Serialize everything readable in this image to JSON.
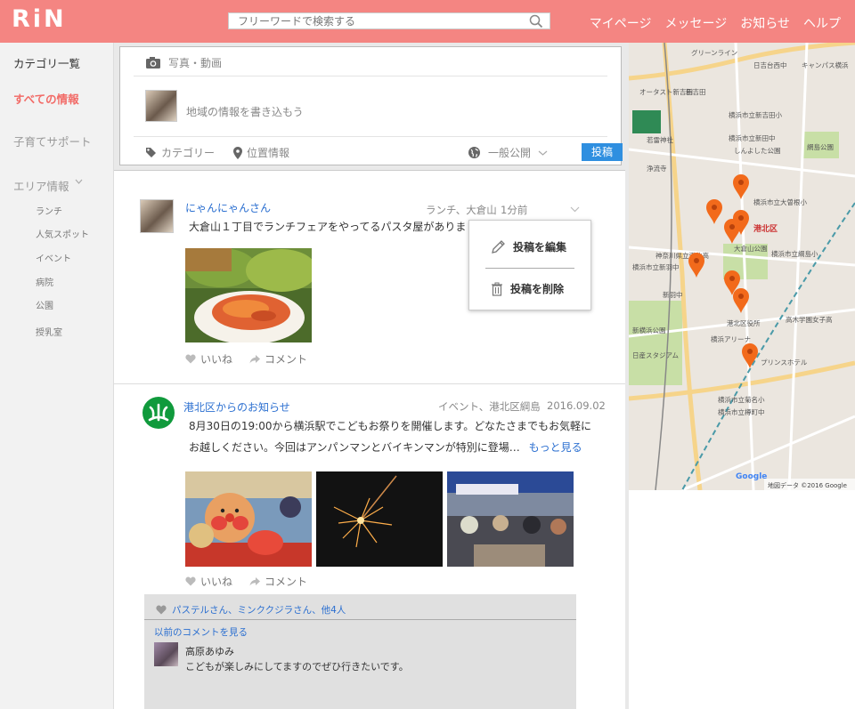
{
  "header": {
    "logo": "RiN",
    "search_placeholder": "フリーワードで検索する",
    "nav": [
      "マイページ",
      "メッセージ",
      "お知らせ",
      "ヘルプ"
    ]
  },
  "sidebar": {
    "category_list": "カテゴリ一覧",
    "all_info": "すべての情報",
    "childcare": "子育てサポート",
    "area_info": "エリア情報",
    "area_items": [
      "ランチ",
      "人気スポット",
      "イベント",
      "病院",
      "公園",
      "授乳室"
    ]
  },
  "composer": {
    "photo_video": "写真・動画",
    "placeholder": "地域の情報を書き込もう",
    "category": "カテゴリー",
    "location": "位置情報",
    "visibility": "一般公開",
    "post_button": "投稿"
  },
  "posts": [
    {
      "user": "にゃんにゃんさん",
      "meta": "ランチ、大倉山",
      "time": "1分前",
      "text": "大倉山１丁目でランチフェアをやってるパスタ屋がありま",
      "like": "いいね",
      "comment": "コメント"
    },
    {
      "user": "港北区からのお知らせ",
      "meta": "イベント、港北区綱島",
      "time": "2016.09.02",
      "text_line1": "8月30日の19:00から横浜駅でこどもお祭りを開催します。どなたさまでもお気軽に",
      "text_line2": "お越しください。今回はアンパンマンとバイキンマンが特別に登場…",
      "more": "もっと見る",
      "like": "いいね",
      "comment": "コメント"
    }
  ],
  "dropdown": {
    "edit": "投稿を編集",
    "delete": "投稿を削除"
  },
  "comments": {
    "likes": "パステルさん、ミンククジラさん、他4人",
    "previous": "以前のコメントを見る",
    "author": "高原あゆみ",
    "body": "こどもが楽しみにしてますのでぜひ行きたいです。"
  },
  "map": {
    "labels": [
      "グリーンライン",
      "日吉台西中",
      "キャンパス横浜",
      "オータスト新吉田",
      "新吉田",
      "横浜市立新吉田小",
      "横浜市立新田中",
      "しんよした公園",
      "浄流寺",
      "若雷神社",
      "網島公園",
      "横浜市立大曽根小",
      "港北区",
      "横浜市立綱島小",
      "大倉山公園",
      "神奈川県立港北高",
      "横浜市立新羽中",
      "港北区役所",
      "新横浜公園",
      "日産スタジアム",
      "横浜アリーナ",
      "プリンスホテル",
      "横浜市立菊名小",
      "横浜市立樽町中",
      "高木学園女子高",
      "新羽中"
    ],
    "attribution": "地図データ ©2016 Google",
    "google": "Google",
    "pins": 8
  },
  "colors": {
    "header_bg": "#f48582",
    "accent_blue": "#2f8fe0",
    "link_blue": "#2b6fd0",
    "sidebar_red": "#f26b67",
    "pin_orange": "#f26a1b"
  }
}
